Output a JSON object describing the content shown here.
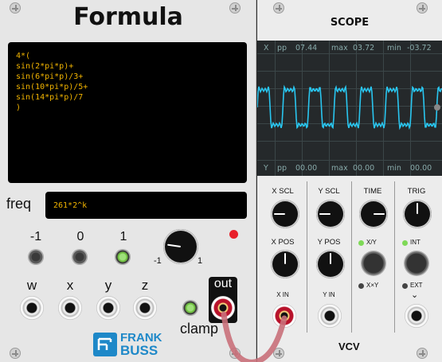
{
  "formula": {
    "title": "Formula",
    "code_lines": [
      "4*(",
      "sin(2*pi*p)+",
      "sin(6*pi*p)/3+",
      "sin(10*pi*p)/5+",
      "sin(14*pi*p)/7",
      ")"
    ],
    "freq_label": "freq",
    "freq_value": "261*2^k",
    "button_labels": [
      "-1",
      "0",
      "1"
    ],
    "knob_min": "-1",
    "knob_max": "1",
    "inputs": [
      "w",
      "x",
      "y",
      "z"
    ],
    "out_label": "out",
    "clamp_label": "clamp",
    "brand_line1": "FRANK",
    "brand_line2": "BUSS"
  },
  "scope": {
    "title": "SCOPE",
    "top_readout": {
      "channel": "X",
      "pp_label": "pp",
      "pp": "07.44",
      "max_label": "max",
      "max": "03.72",
      "min_label": "min",
      "min": "-03.72"
    },
    "bottom_readout": {
      "channel": "Y",
      "pp_label": "pp",
      "pp": "00.00",
      "max_label": "max",
      "max": "00.00",
      "min_label": "min",
      "min": "00.00"
    },
    "knob_labels_row1": [
      "X SCL",
      "Y SCL",
      "TIME",
      "TRIG"
    ],
    "knob_labels_row2": [
      "X POS",
      "Y POS"
    ],
    "mode_xy": "X/Y",
    "mode_xtimesy": "X×Y",
    "trig_int": "INT",
    "trig_ext": "EXT",
    "jack_labels": [
      "X IN",
      "Y IN"
    ],
    "brand": "VCV"
  },
  "colors": {
    "code": "#f2b400",
    "trace": "#29c6f0",
    "led_red": "#e8202a",
    "led_green": "#7ed957",
    "cable": "#c9707a"
  }
}
